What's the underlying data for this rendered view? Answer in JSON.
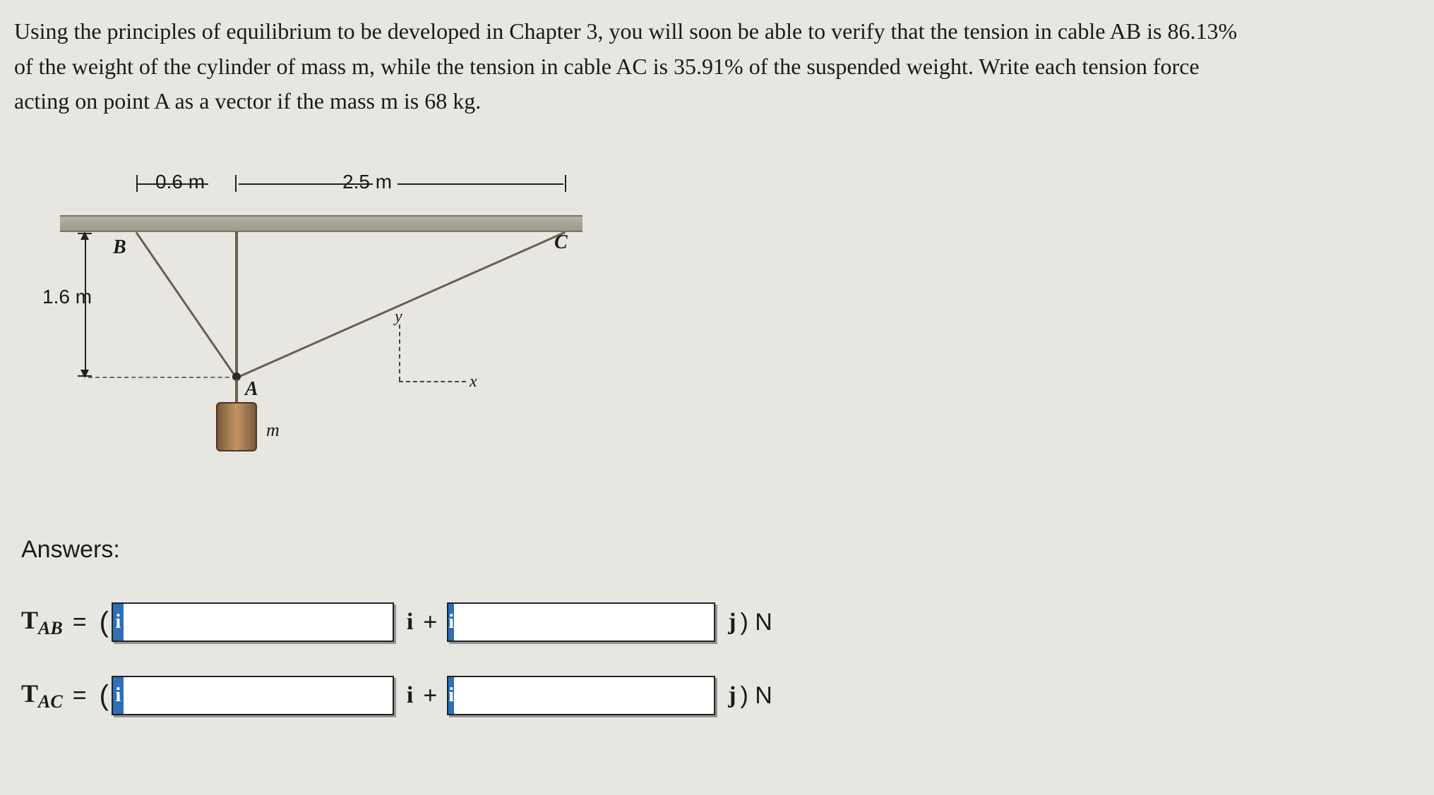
{
  "problem": {
    "line1": "Using the principles of equilibrium to be developed in Chapter 3, you will soon be able to verify that the tension in cable AB is 86.13%",
    "line2": "of the weight of the cylinder of mass m, while the tension in cable AC is 35.91% of the suspended weight. Write each tension force",
    "line3": "acting on point A as a vector if the mass m is 68 kg."
  },
  "diagram": {
    "dim_0_6": "0.6 m",
    "dim_2_5": "2.5 m",
    "dim_1_6": "1.6 m",
    "B": "B",
    "C": "C",
    "A": "A",
    "m": "m",
    "x": "x",
    "y": "y"
  },
  "answers": {
    "title": "Answers:",
    "rows": [
      {
        "label_main": "T",
        "label_sub": "AB",
        "eq": "=",
        "open": "(",
        "hint": "i",
        "i_unit": "i",
        "plus": "+",
        "j_unit": "j",
        "close_unit": ") N"
      },
      {
        "label_main": "T",
        "label_sub": "AC",
        "eq": "=",
        "open": "(",
        "hint": "i",
        "i_unit": "i",
        "plus": "+",
        "j_unit": "j",
        "close_unit": ") N"
      }
    ]
  }
}
